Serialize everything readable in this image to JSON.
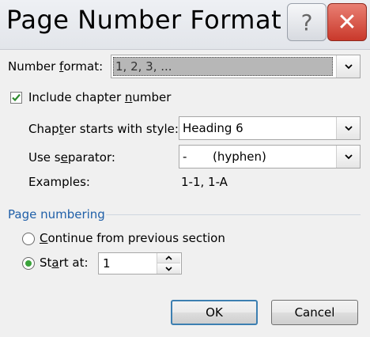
{
  "window": {
    "title": "Page Number Format",
    "help_glyph": "?",
    "close_glyph": "✕"
  },
  "number_format": {
    "label_pre": "Number ",
    "label_ul": "f",
    "label_post": "ormat:",
    "value": "1, 2, 3, ..."
  },
  "include_chapter": {
    "checked": true,
    "label_pre": "Include chapter ",
    "label_ul": "n",
    "label_post": "umber"
  },
  "chapter_style": {
    "label_pre": "Chap",
    "label_ul": "t",
    "label_post": "er starts with style:",
    "value": "Heading 6"
  },
  "separator": {
    "label_pre": "Use s",
    "label_ul": "e",
    "label_post": "parator:",
    "value_char": "-",
    "value_name": "(hyphen)"
  },
  "examples": {
    "label": "Examples:",
    "value": "1-1, 1-A"
  },
  "page_numbering": {
    "heading": "Page numbering",
    "continue_label_ul": "C",
    "continue_label_post": "ontinue from previous section",
    "start_label_pre": "St",
    "start_label_ul": "a",
    "start_label_post": "rt at:",
    "start_value": "1",
    "selected": "start_at"
  },
  "buttons": {
    "ok": "OK",
    "cancel": "Cancel"
  },
  "colors": {
    "accent_blue": "#1f5fa8",
    "check_green": "#2e8b2e"
  }
}
